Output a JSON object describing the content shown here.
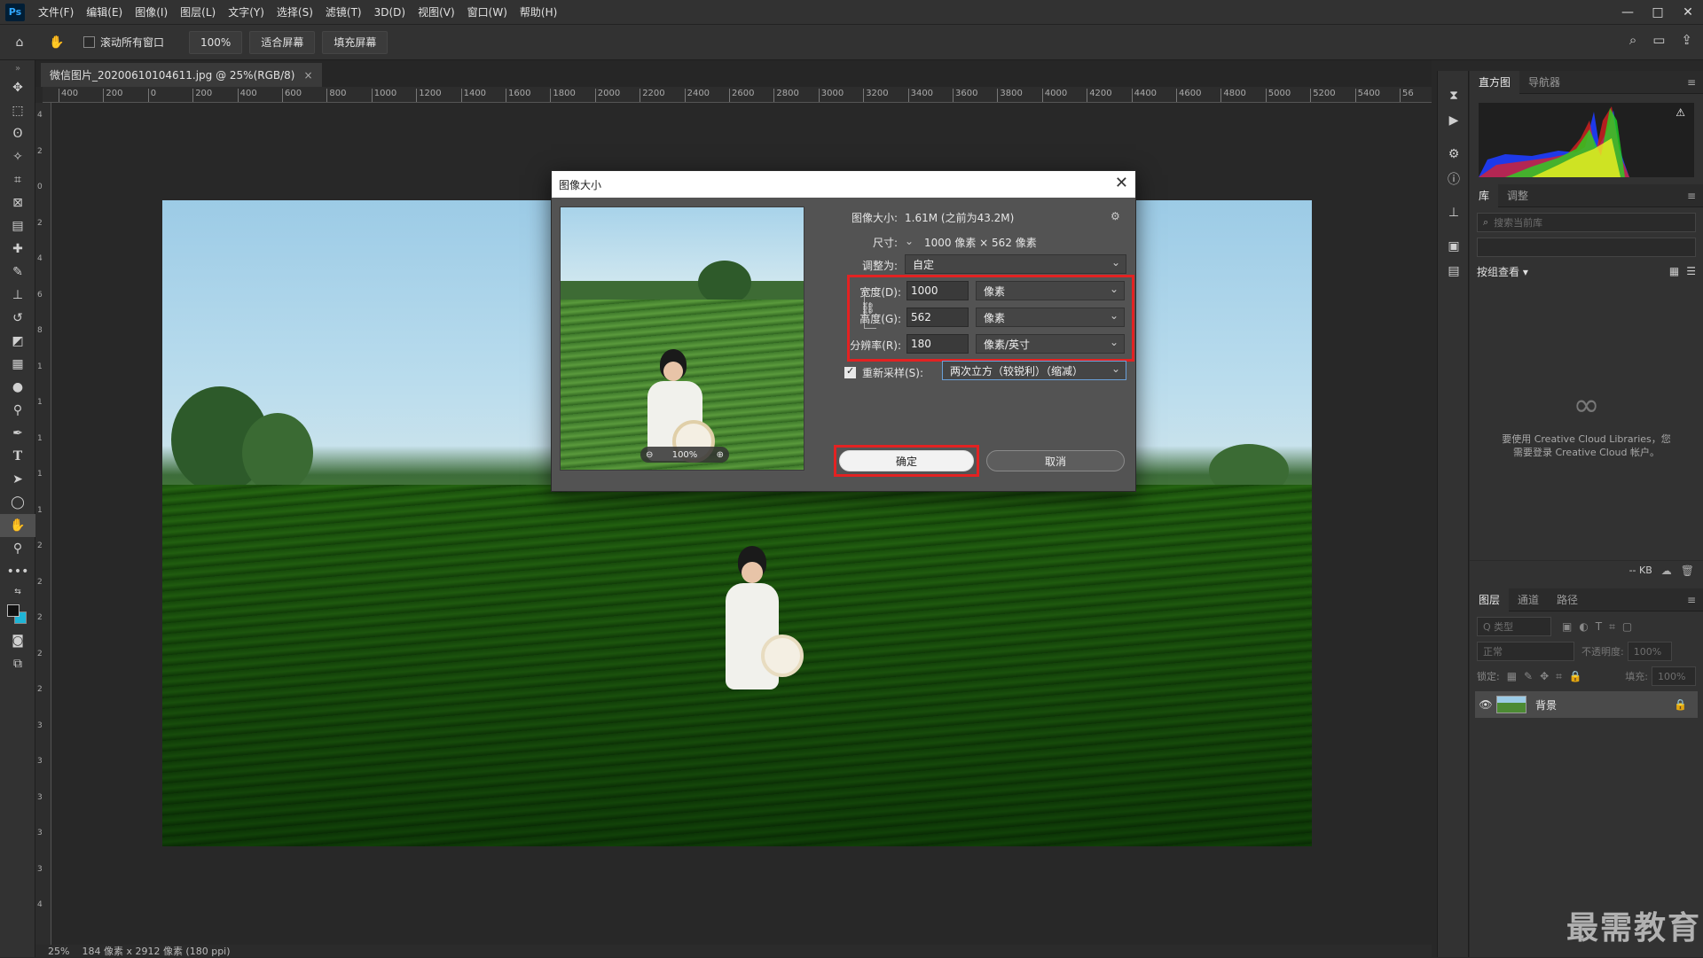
{
  "app": {
    "logo": "Ps",
    "menu": [
      "文件(F)",
      "编辑(E)",
      "图像(I)",
      "图层(L)",
      "文字(Y)",
      "选择(S)",
      "滤镜(T)",
      "3D(D)",
      "视图(V)",
      "窗口(W)",
      "帮助(H)"
    ],
    "window_controls": [
      "—",
      "□",
      "✕"
    ]
  },
  "options": {
    "scroll_all_label": "滚动所有窗口",
    "scroll_all_checked": false,
    "zoom_value": "100%",
    "fit_screen": "适合屏幕",
    "fill_screen": "填充屏幕"
  },
  "document": {
    "tab_title": "微信图片_20200610104611.jpg @ 25%(RGB/8)",
    "tab_close": "×",
    "status_zoom": "25%",
    "status_info": "184 像素 x 2912 像素 (180 ppi)"
  },
  "ruler": {
    "h_ticks": [
      "400",
      "200",
      "0",
      "200",
      "400",
      "600",
      "800",
      "1000",
      "1200",
      "1400",
      "1600",
      "1800",
      "2000",
      "2200",
      "2400",
      "2600",
      "2800",
      "3000",
      "3200",
      "3400",
      "3600",
      "3800",
      "4000",
      "4200",
      "4400",
      "4600",
      "4800",
      "5000",
      "5200",
      "5400",
      "56"
    ],
    "v_ticks": [
      "4",
      "2",
      "0",
      "2",
      "4",
      "6",
      "8",
      "1",
      "1",
      "1",
      "1",
      "1",
      "2",
      "2",
      "2",
      "2",
      "2",
      "3",
      "3",
      "3",
      "3",
      "3",
      "4"
    ]
  },
  "dialog": {
    "title": "图像大小",
    "close": "✕",
    "image_size_label": "图像大小:",
    "image_size_value": "1.61M (之前为43.2M)",
    "dimensions_label": "尺寸:",
    "dimensions_value": "1000 像素 × 562 像素",
    "fit_to_label": "调整为:",
    "fit_to_value": "自定",
    "width_label": "宽度(D):",
    "width_value": "1000",
    "width_unit": "像素",
    "height_label": "高度(G):",
    "height_value": "562",
    "height_unit": "像素",
    "resolution_label": "分辨率(R):",
    "resolution_value": "180",
    "resolution_unit": "像素/英寸",
    "resample_label": "重新采样(S):",
    "resample_checked": true,
    "resample_value": "两次立方（较锐利）（缩减）",
    "preview_zoom": "100%",
    "ok": "确定",
    "cancel": "取消"
  },
  "panels": {
    "top_tabs": [
      "直方图",
      "导航器"
    ],
    "lib_tabs": [
      "库",
      "调整"
    ],
    "lib_search_placeholder": "搜索当前库",
    "lib_view_label": "按组查看 ▾",
    "lib_message_1": "要使用 Creative Cloud Libraries，您",
    "lib_message_2": "需要登录 Creative Cloud 帐户。",
    "lib_size": "-- KB",
    "layer_tabs": [
      "图层",
      "通道",
      "路径"
    ],
    "layer_filter_placeholder": "Q 类型",
    "blend_mode": "正常",
    "opacity_label": "不透明度:",
    "opacity_value": "100%",
    "lock_label": "锁定:",
    "fill_label": "填充:",
    "fill_value": "100%",
    "layer_name": "背景"
  },
  "watermark": "最需教育",
  "colors": {
    "highlight": "#e32222",
    "panel_bg": "#323232",
    "dialog_bg": "#535353"
  }
}
